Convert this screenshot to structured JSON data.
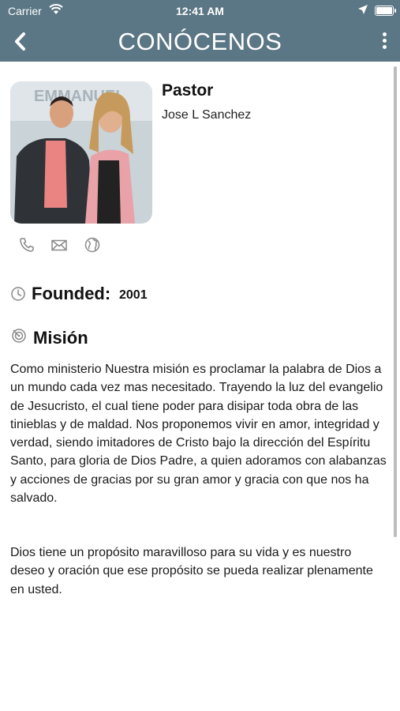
{
  "status_bar": {
    "carrier": "Carrier",
    "time": "12:41 AM"
  },
  "nav": {
    "title": "CONÓCENOS",
    "back_icon": "chevron-left-icon",
    "menu_icon": "more-vertical-icon"
  },
  "pastor": {
    "label": "Pastor",
    "name": "Jose L Sanchez",
    "photo_sign_text": "EMMANUEL"
  },
  "contact_icons": [
    "phone-icon",
    "mail-icon",
    "globe-icon"
  ],
  "founded": {
    "label": "Founded:",
    "value": "2001"
  },
  "mision": {
    "label": "Misión",
    "paragraphs": [
      "Como ministerio Nuestra misión es proclamar la palabra de Dios a un mundo cada vez mas necesitado. Trayendo la luz del evangelio de Jesucristo, el cual tiene poder para disipar toda obra de las tinieblas y de maldad. Nos proponemos vivir en amor, integridad y verdad, siendo imitadores de Cristo bajo la dirección del Espíritu Santo, para gloria de Dios Padre, a quien adoramos con alabanzas y acciones de gracias por su gran amor y gracia con que nos ha salvado.",
      "Dios tiene un propósito maravilloso para su vida y es nuestro deseo y oración que ese propósito se pueda realizar plenamente en usted."
    ]
  },
  "colors": {
    "header_bg": "#5b7684",
    "header_text": "#ffffff",
    "body_text": "#1a1a1a",
    "icon_gray": "#8a8a8a"
  }
}
